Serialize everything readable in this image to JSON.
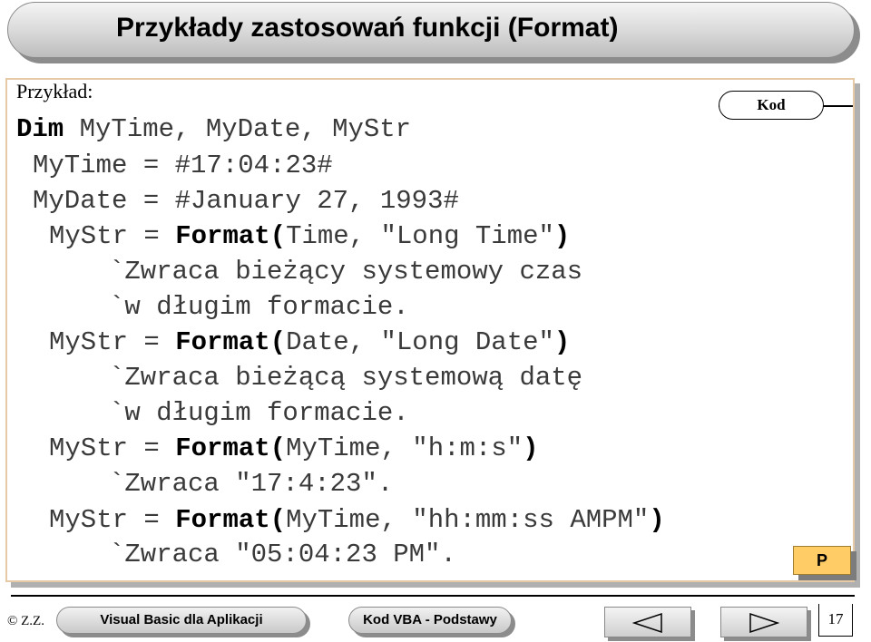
{
  "title": "Przykłady zastosowań funkcji (Format)",
  "example_label": "Przykład:",
  "kod_badge": "Kod",
  "code": {
    "l1_kw": "Dim",
    "l1_rest": " MyTime, MyDate, MyStr",
    "l2": "MyTime = #17:04:23#",
    "l3": "MyDate = #January 27, 1993#",
    "l4_a": "MyStr = ",
    "l4_kw": "Format(",
    "l4_b": "Time, \"Long Time\"",
    "l4_kw2": ")",
    "l5": "`Zwraca bieżący systemowy czas",
    "l6": "`w długim formacie.",
    "l7_a": "MyStr = ",
    "l7_kw": "Format(",
    "l7_b": "Date, \"Long Date\"",
    "l7_kw2": ")",
    "l8": "`Zwraca bieżącą systemową datę",
    "l9": "`w długim formacie.",
    "l10_a": "MyStr = ",
    "l10_kw": "Format(",
    "l10_b": "MyTime, \"h:m:s\"",
    "l10_kw2": ")",
    "l11": "`Zwraca \"17:4:23\".",
    "l12_a": "MyStr = ",
    "l12_kw": "Format(",
    "l12_b": "MyTime, \"hh:mm:ss AMPM\"",
    "l12_kw2": ")",
    "l13": "`Zwraca \"05:04:23 PM\"."
  },
  "p_button": "P",
  "footer": {
    "author": "© Z.Z.",
    "course": "Visual Basic dla Aplikacji",
    "section": "Kod VBA - Podstawy",
    "page_number": "17",
    "prev_icon": "triangle-left-icon",
    "next_icon": "triangle-right-icon"
  }
}
